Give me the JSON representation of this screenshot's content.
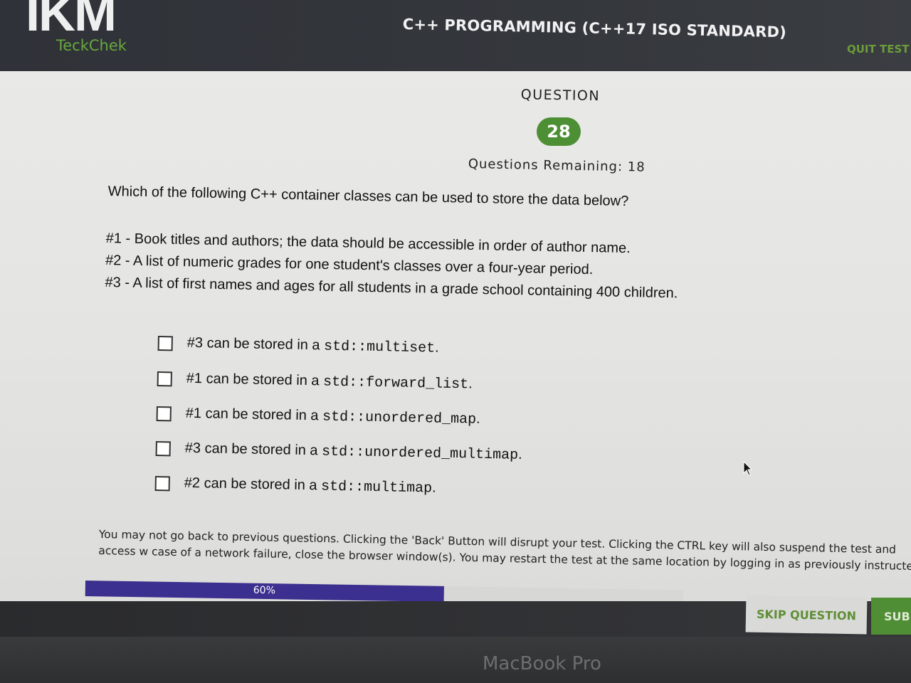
{
  "header": {
    "logo_main": "IKM",
    "logo_sub": "TeckChek",
    "title": "C++ PROGRAMMING (C++17 ISO STANDARD)",
    "quit_label": "QUIT TEST"
  },
  "question": {
    "label": "QUESTION",
    "number": "28",
    "remaining": "Questions Remaining: 18",
    "prompt": "Which of the following C++ container classes can be used to store the data below?",
    "items": [
      "#1 - Book titles and authors; the data should be accessible in order of author name.",
      "#2 - A list of numeric grades for one student's classes over a four-year period.",
      "#3 - A list of first names and ages for all students in a grade school containing 400 children."
    ]
  },
  "options": [
    {
      "prefix": "#3 can be stored in a ",
      "code": "std::multiset",
      "suffix": "."
    },
    {
      "prefix": "#1 can be stored in a ",
      "code": "std::forward_list",
      "suffix": "."
    },
    {
      "prefix": "#1 can be stored in a ",
      "code": "std::unordered_map",
      "suffix": "."
    },
    {
      "prefix": "#3 can be stored in a ",
      "code": "std::unordered_multimap",
      "suffix": "."
    },
    {
      "prefix": "#2 can be stored in a ",
      "code": "std::multimap",
      "suffix": "."
    }
  ],
  "notice": "You may not go back to previous questions. Clicking the 'Back' Button will disrupt your test. Clicking the CTRL key will also suspend the test and access w case of a network failure, close the browser window(s). You may restart the test at the same location by logging in as previously instructed.",
  "progress": {
    "percent": 60,
    "label": "60%"
  },
  "footer": {
    "skip_label": "SKIP QUESTION",
    "submit_label": "SUBMIT"
  },
  "device": {
    "label": "MacBook Pro"
  },
  "colors": {
    "accent_green": "#4d8f34",
    "progress_purple": "#3b2f8f",
    "header_dark": "#34373c"
  }
}
